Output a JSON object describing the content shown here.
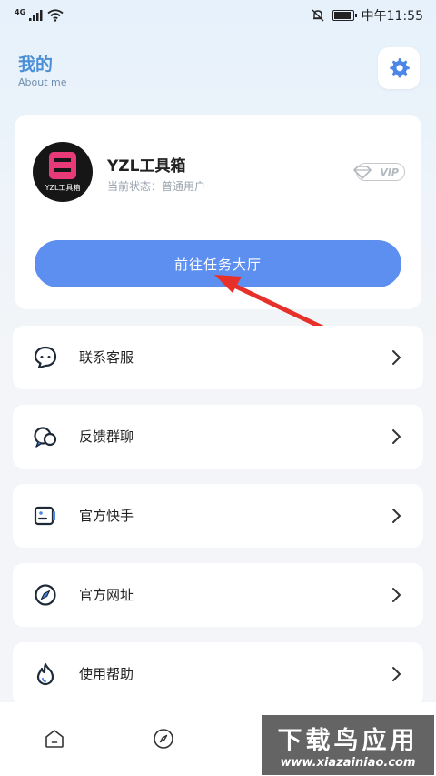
{
  "status_bar": {
    "network": "4G",
    "time": "中午11:55",
    "battery_level": 0.9
  },
  "header": {
    "title": "我的",
    "subtitle": "About me"
  },
  "profile": {
    "avatar_text": "YZL工具箱",
    "username": "YZL工具箱",
    "status": "当前状态：普通用户",
    "vip_label": "VIP",
    "task_button_label": "前往任务大厅"
  },
  "menu": {
    "items": [
      {
        "label": "联系客服",
        "icon": "chat-bubble-icon"
      },
      {
        "label": "反馈群聊",
        "icon": "group-chat-icon"
      },
      {
        "label": "官方快手",
        "icon": "video-camera-icon"
      },
      {
        "label": "官方网址",
        "icon": "compass-icon"
      },
      {
        "label": "使用帮助",
        "icon": "flame-icon"
      }
    ]
  },
  "watermark": {
    "title": "下载鸟应用",
    "url": "www.xiazainiao.com"
  },
  "colors": {
    "accent": "#5d8ff0",
    "title_blue": "#4a8fd6",
    "annotation_arrow": "#e8302a"
  }
}
